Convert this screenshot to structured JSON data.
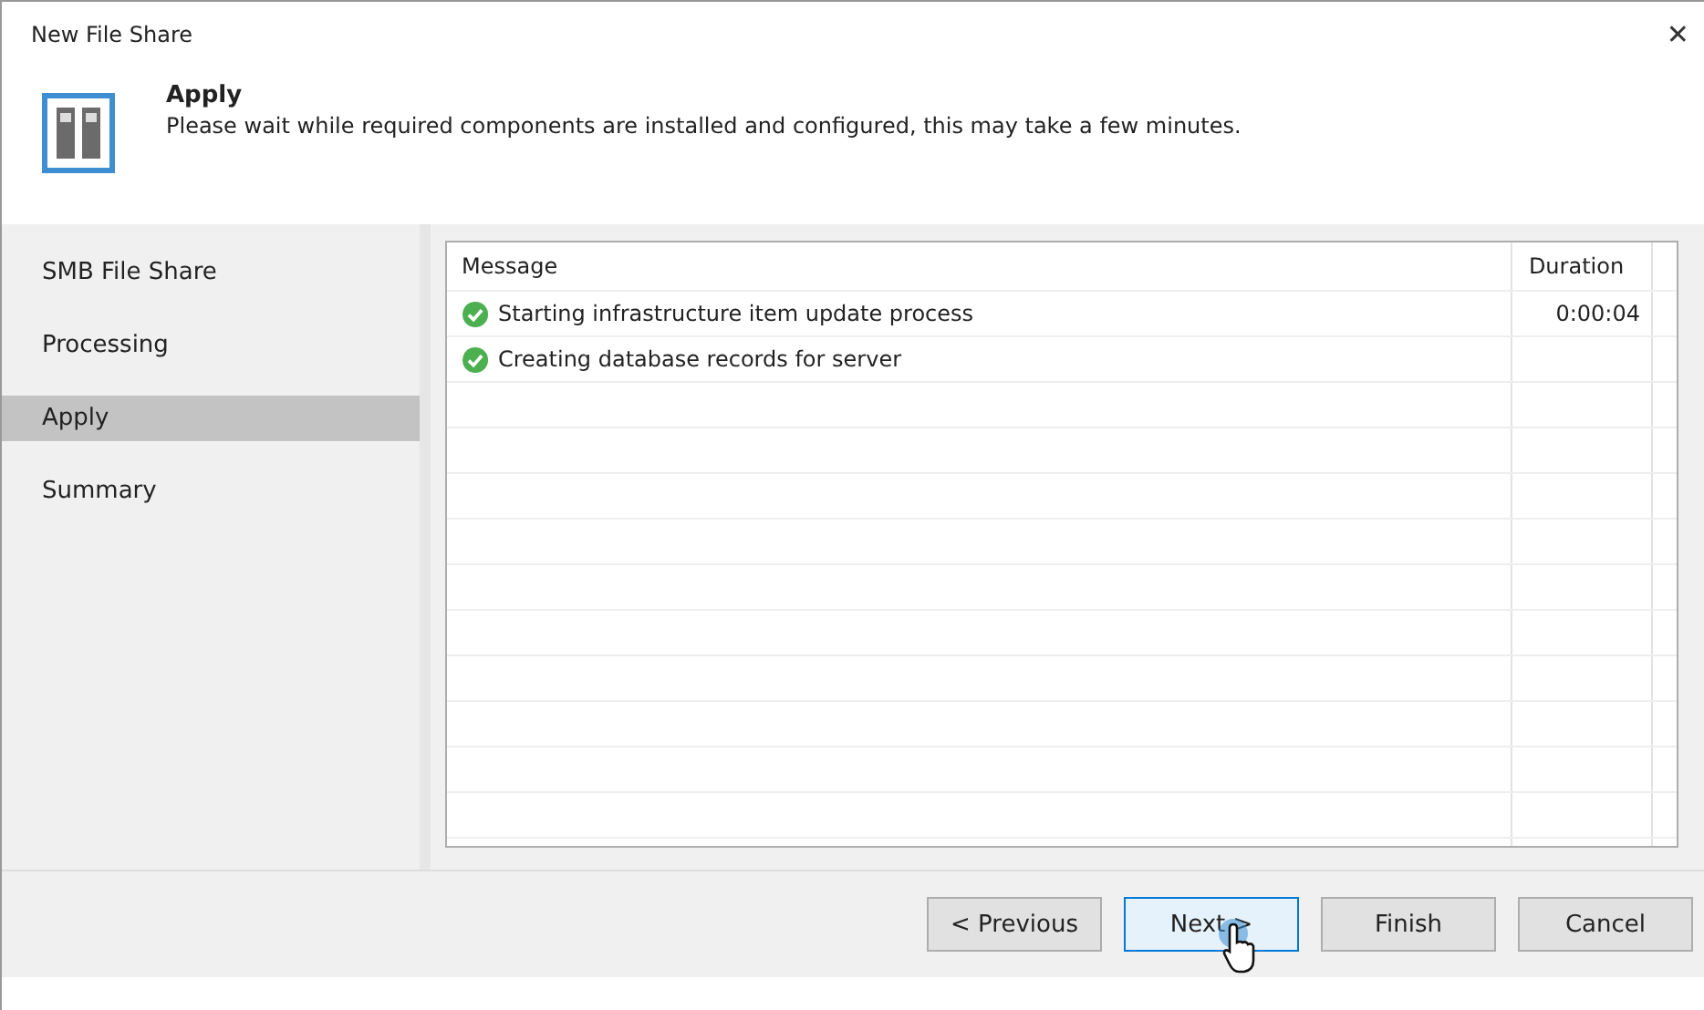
{
  "window": {
    "title": "New File Share",
    "close": "✕"
  },
  "header": {
    "title": "Apply",
    "description": "Please wait while required components are installed and configured, this may take a few minutes."
  },
  "sidebar": {
    "items": [
      {
        "label": "SMB File Share",
        "selected": false
      },
      {
        "label": "Processing",
        "selected": false
      },
      {
        "label": "Apply",
        "selected": true
      },
      {
        "label": "Summary",
        "selected": false
      }
    ]
  },
  "table": {
    "columns": [
      "Message",
      "Duration"
    ],
    "rows": [
      {
        "kind": "success",
        "message": "Starting infrastructure item update process",
        "duration": "0:00:04"
      },
      {
        "kind": "success",
        "message": "Creating database records for server"
      }
    ]
  },
  "buttons": [
    {
      "label": "< Previous",
      "focused": false
    },
    {
      "label": "Next >",
      "focused": true
    },
    {
      "label": "Finish",
      "focused": false
    },
    {
      "label": "Cancel",
      "focused": false
    }
  ]
}
